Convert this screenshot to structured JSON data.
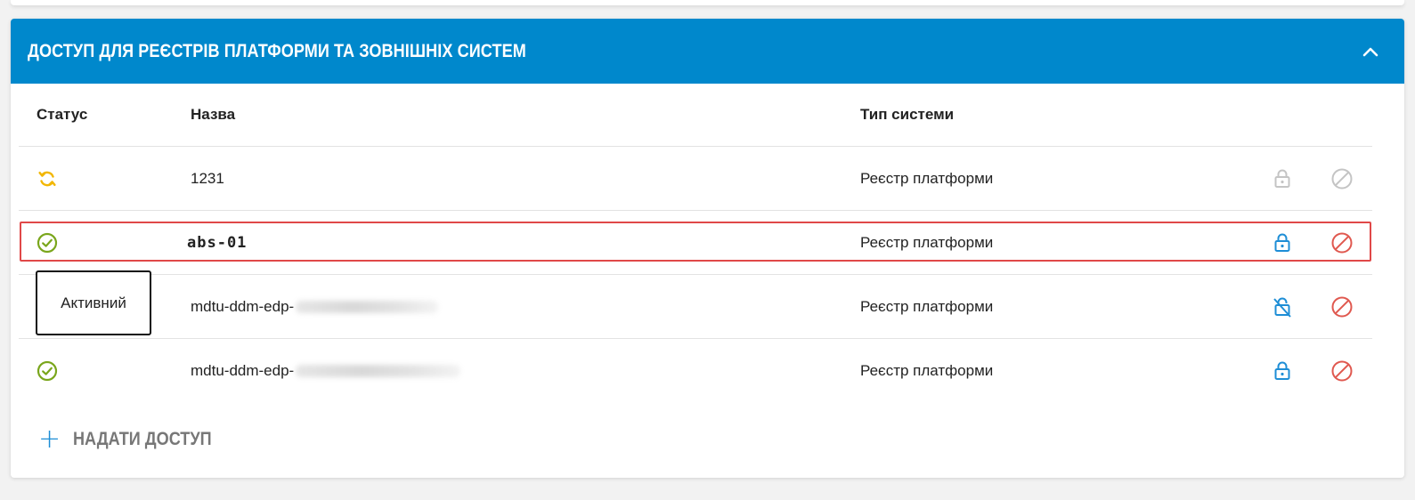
{
  "section": {
    "title": "ДОСТУП ДЛЯ РЕЄСТРІВ ПЛАТФОРМИ ТА ЗОВНІШНІХ СИСТЕМ",
    "collapse_icon": "chevron-up-icon"
  },
  "table": {
    "headers": {
      "status": "Статус",
      "name": "Назва",
      "type": "Тип системи"
    },
    "rows": [
      {
        "status": "syncing",
        "name": "1231",
        "name_suffix": "",
        "type": "Реєстр платформи",
        "lock": "disabled",
        "block": "disabled"
      },
      {
        "status": "active",
        "name": "abs-01",
        "name_suffix": "",
        "type": "Реєстр платформи",
        "lock": "locked",
        "block": "enabled"
      },
      {
        "status": "active",
        "name": "mdtu-ddm-edp-",
        "name_suffix": "[blurred]",
        "type": "Реєстр платформи",
        "lock": "unlocked",
        "block": "enabled"
      },
      {
        "status": "active",
        "name": "mdtu-ddm-edp-",
        "name_suffix": "[blurred]",
        "type": "Реєстр платформи",
        "lock": "locked",
        "block": "enabled"
      }
    ]
  },
  "tooltip": {
    "text": "Активний"
  },
  "actions": {
    "add_access_label": "НАДАТИ ДОСТУП"
  },
  "colors": {
    "header_bg": "#0088cc",
    "status_active": "#7aa61c",
    "status_syncing": "#f2b705",
    "lock_blue": "#1e8ed6",
    "block_red": "#e0584f",
    "disabled_gray": "#c4c4c4",
    "highlight_red": "#e04848"
  }
}
